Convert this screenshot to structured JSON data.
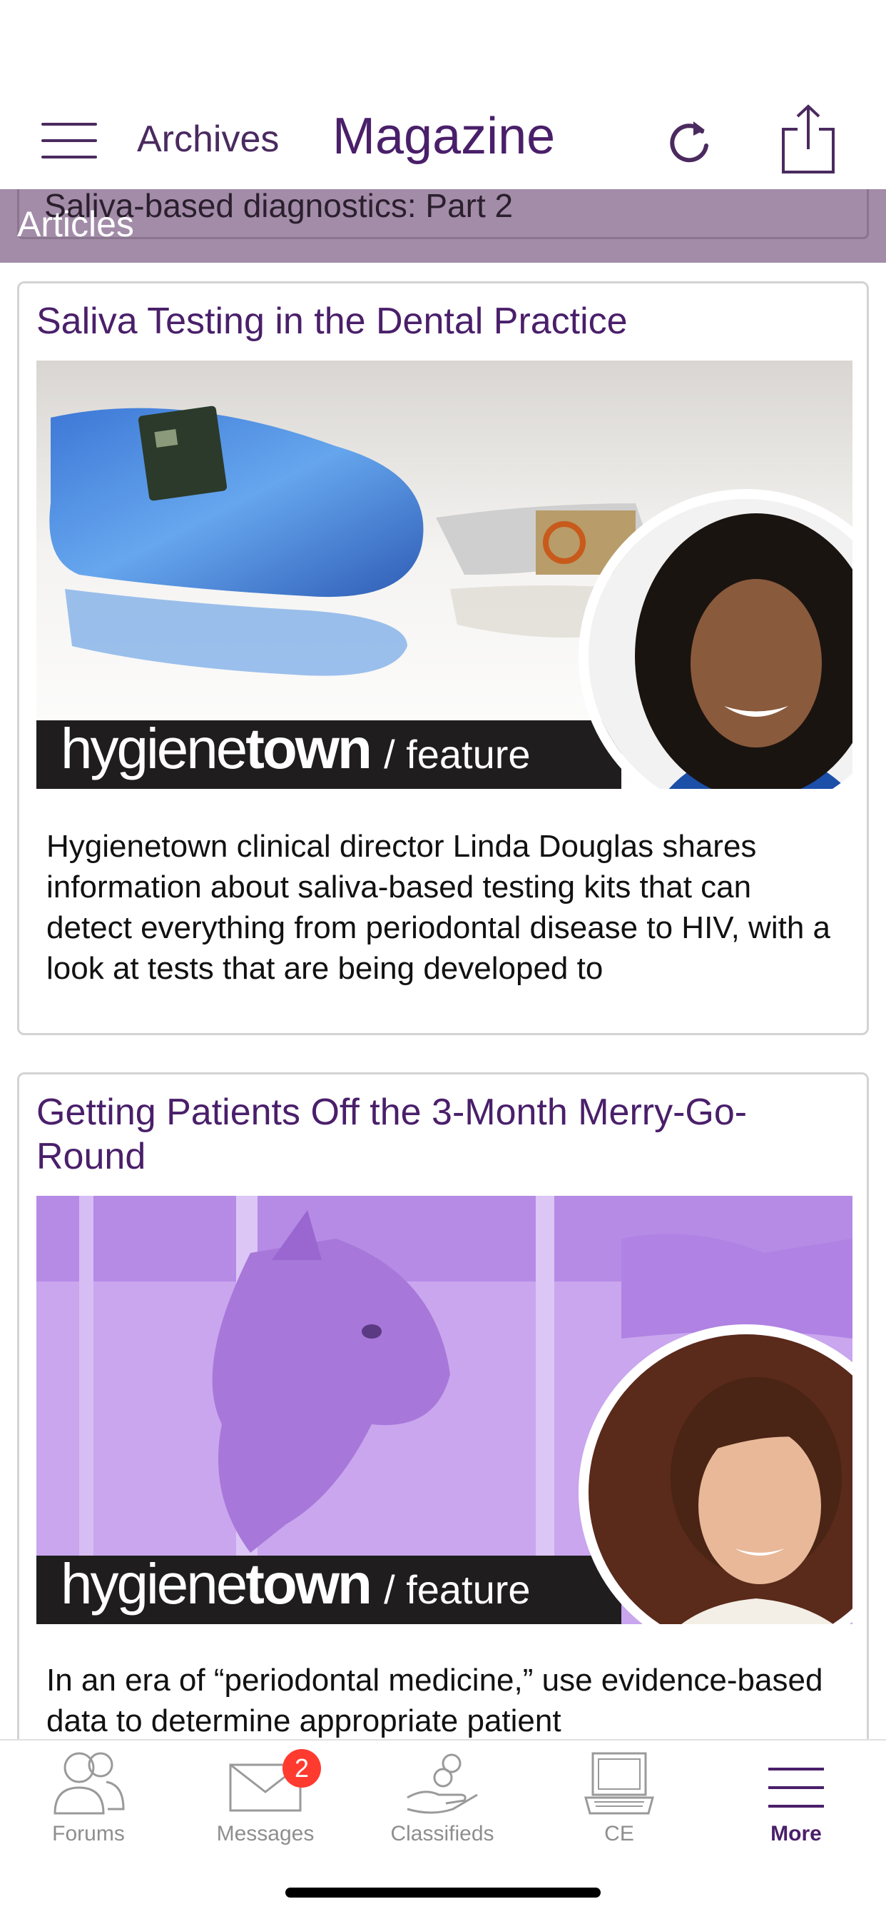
{
  "header": {
    "archives_label": "Archives",
    "title": "Magazine"
  },
  "articles_bar": {
    "label": "Articles",
    "previous_title": "Saliva-based diagnostics: Part 2"
  },
  "articles": [
    {
      "title": "Saliva Testing in the Dental Practice",
      "banner_brand_light": "hygiene",
      "banner_brand_bold": "town",
      "banner_feature": "/ feature",
      "excerpt": "Hygienetown clinical director Linda Douglas shares information about saliva-based testing kits that can detect everything from periodontal disease to HIV, with a look at tests that are being developed to"
    },
    {
      "title": "Getting Patients Off the 3-Month Merry-Go-Round",
      "banner_brand_light": "hygiene",
      "banner_brand_bold": "town",
      "banner_feature": "/ feature",
      "excerpt": "In an era of “periodontal medicine,” use evidence-based data to determine appropriate patient"
    }
  ],
  "tabbar": {
    "forums": "Forums",
    "messages": "Messages",
    "messages_badge": "2",
    "classifieds": "Classifieds",
    "ce": "CE",
    "more": "More"
  },
  "colors": {
    "brand_purple": "#4a1f6a",
    "articles_bar": "#a28ca8",
    "badge_red": "#ff3b30"
  }
}
